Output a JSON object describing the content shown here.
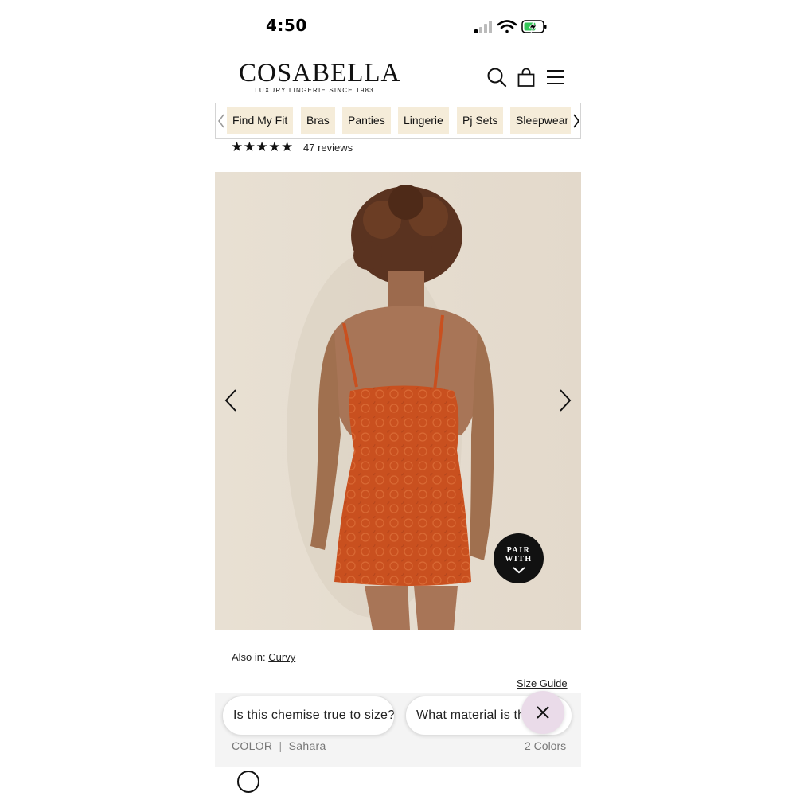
{
  "status_bar": {
    "time": "4:50"
  },
  "brand": {
    "logo": "COSABELLA",
    "tagline": "LUXURY LINGERIE SINCE 1983"
  },
  "header_icons": [
    "search-icon",
    "shopping-bag-icon",
    "hamburger-menu-icon"
  ],
  "category_nav": {
    "items": [
      {
        "label": "Find My Fit"
      },
      {
        "label": "Bras"
      },
      {
        "label": "Panties"
      },
      {
        "label": "Lingerie"
      },
      {
        "label": "Pj Sets"
      },
      {
        "label": "Sleepwear"
      }
    ],
    "chip_color": "#f5ecd9"
  },
  "rating": {
    "stars": "★★★★★",
    "value": 5,
    "reviews_label": "47 reviews"
  },
  "product_image": {
    "pair_with_line1": "PAIR",
    "pair_with_line2": "WITH"
  },
  "product": {
    "also_in_label": "Also in:",
    "also_in_link": "Curvy",
    "size_guide": "Size Guide",
    "color_label": "COLOR",
    "color_value": "Sahara",
    "color_count": "2 Colors",
    "dress_color": "#c9501f"
  },
  "suggestions": [
    {
      "text": "Is this chemise true to size?"
    },
    {
      "text": "What material is the"
    }
  ]
}
